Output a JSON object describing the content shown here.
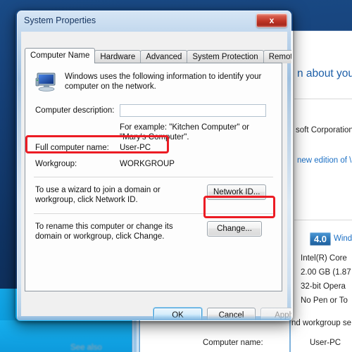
{
  "dialog": {
    "title": "System Properties",
    "close_label": "x",
    "close_icon": "close-icon",
    "tabs": [
      {
        "label": "Computer Name",
        "active": true
      },
      {
        "label": "Hardware",
        "active": false
      },
      {
        "label": "Advanced",
        "active": false
      },
      {
        "label": "System Protection",
        "active": false
      },
      {
        "label": "Remote",
        "active": false
      }
    ],
    "intro": {
      "icon": "computer-monitor-icon",
      "text": "Windows uses the following information to identify your computer on the network."
    },
    "fields": {
      "description_label": "Computer description:",
      "description_value": "",
      "description_placeholder": "",
      "example_text": "For example: \"Kitchen Computer\" or \"Mary's Computer\".",
      "full_name_label": "Full computer name:",
      "full_name_value": "User-PC",
      "workgroup_label": "Workgroup:",
      "workgroup_value": "WORKGROUP"
    },
    "wizard": {
      "text": "To use a wizard to join a domain or workgroup, click Network ID.",
      "button_label": "Network ID..."
    },
    "rename": {
      "text": "To rename this computer or change its domain or workgroup, click Change.",
      "button_label": "Change..."
    },
    "commands": {
      "ok_label": "OK",
      "cancel_label": "Cancel",
      "apply_label": "Apply"
    },
    "annotations": {
      "accent_color": "#ec1c24",
      "highlighted": [
        "workgroup-row",
        "change-button"
      ]
    }
  },
  "background_window": {
    "heading": "n about your",
    "copyright_text": "soft Corporation",
    "upgrade_link": "new edition of \\",
    "rating_value": "4.0",
    "rating_label": "Wind",
    "specs": [
      "Intel(R) Core",
      "2.00 GB (1.87",
      "32-bit Opera",
      "No Pen or To"
    ],
    "section_heading": "nd workgroup se",
    "detail_rows": [
      {
        "label": "Computer name:",
        "value": "User-PC"
      }
    ],
    "see_also_label": "See also"
  }
}
